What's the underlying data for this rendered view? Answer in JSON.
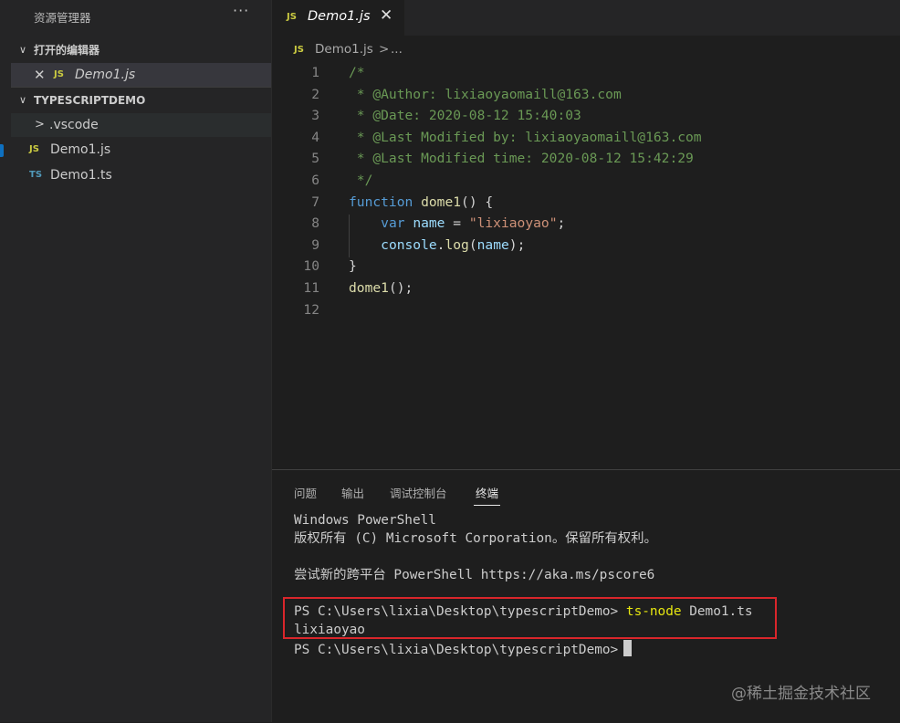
{
  "sidebar": {
    "title": "资源管理器",
    "more": "···",
    "open_editors": {
      "chevron": "∨",
      "label": "打开的编辑器",
      "items": [
        {
          "close": "✕",
          "icon": "JS",
          "label": "Demo1.js"
        }
      ]
    },
    "project": {
      "chevron": "∨",
      "label": "TYPESCRIPTDEMO",
      "items": [
        {
          "chevron": ">",
          "label": ".vscode"
        },
        {
          "icon": "JS",
          "label": "Demo1.js"
        },
        {
          "icon": "TS",
          "label": "Demo1.ts"
        }
      ]
    }
  },
  "editor": {
    "tab": {
      "icon": "JS",
      "label": "Demo1.js",
      "close": "✕"
    },
    "breadcrumb": {
      "icon": "JS",
      "file": "Demo1.js",
      "sep": ">",
      "rest": "..."
    },
    "line_numbers": [
      "1",
      "2",
      "3",
      "4",
      "5",
      "6",
      "7",
      "8",
      "9",
      "10",
      "11",
      "12"
    ],
    "lines": [
      [
        {
          "t": "/*",
          "c": "c-com"
        }
      ],
      [
        {
          "t": " * @Author: lixiaoyaomaill@163.com",
          "c": "c-com"
        }
      ],
      [
        {
          "t": " * @Date: 2020-08-12 15:40:03",
          "c": "c-com"
        }
      ],
      [
        {
          "t": " * @Last Modified by: lixiaoyaomaill@163.com",
          "c": "c-com"
        }
      ],
      [
        {
          "t": " * @Last Modified time: 2020-08-12 15:42:29",
          "c": "c-com"
        }
      ],
      [
        {
          "t": " */",
          "c": "c-com"
        }
      ],
      [
        {
          "t": "function",
          "c": "c-kw"
        },
        {
          "t": " ",
          "c": "c-pl"
        },
        {
          "t": "dome1",
          "c": "c-fn"
        },
        {
          "t": "() {",
          "c": "c-pl"
        }
      ],
      [
        {
          "t": "    ",
          "c": "c-pl"
        },
        {
          "t": "var",
          "c": "c-kw"
        },
        {
          "t": " ",
          "c": "c-pl"
        },
        {
          "t": "name",
          "c": "c-var"
        },
        {
          "t": " = ",
          "c": "c-pl"
        },
        {
          "t": "\"lixiaoyao\"",
          "c": "c-str"
        },
        {
          "t": ";",
          "c": "c-pl"
        }
      ],
      [
        {
          "t": "    ",
          "c": "c-pl"
        },
        {
          "t": "console",
          "c": "c-var"
        },
        {
          "t": ".",
          "c": "c-pl"
        },
        {
          "t": "log",
          "c": "c-fn"
        },
        {
          "t": "(",
          "c": "c-pl"
        },
        {
          "t": "name",
          "c": "c-var"
        },
        {
          "t": ");",
          "c": "c-pl"
        }
      ],
      [
        {
          "t": "}",
          "c": "c-pl"
        }
      ],
      [
        {
          "t": "dome1",
          "c": "c-fn"
        },
        {
          "t": "();",
          "c": "c-pl"
        }
      ],
      [
        {
          "t": "",
          "c": "c-pl"
        }
      ]
    ]
  },
  "panel": {
    "tabs": [
      "问题",
      "输出",
      "调试控制台",
      "终端"
    ],
    "active_tab": "终端",
    "terminal": {
      "l1": "Windows PowerShell",
      "l2": "版权所有 (C) Microsoft Corporation。保留所有权利。",
      "l3": "尝试新的跨平台 PowerShell https://aka.ms/pscore6",
      "prompt": "PS C:\\Users\\lixia\\Desktop\\typescriptDemo>",
      "command": "ts-node",
      "command_arg": "Demo1.ts",
      "output": "lixiaoyao"
    }
  },
  "watermark": "@稀土掘金技术社区"
}
